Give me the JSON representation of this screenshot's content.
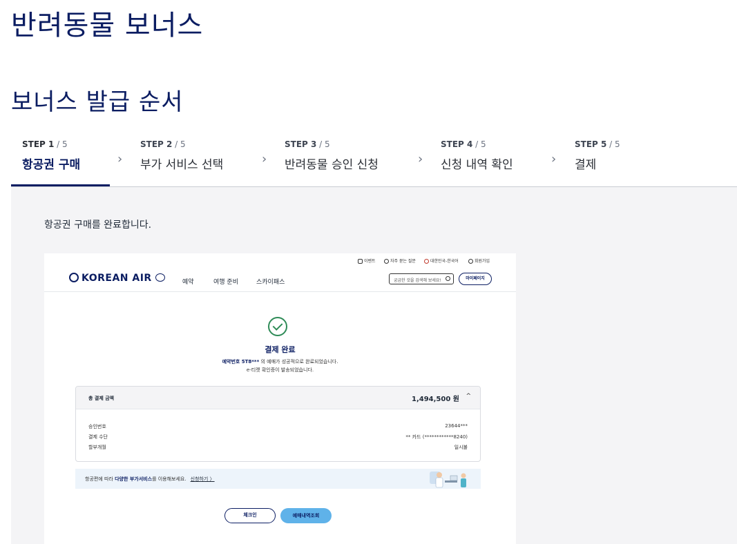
{
  "page": {
    "title": "반려동물 보너스",
    "subtitle": "보너스 발급 순서"
  },
  "steps": [
    {
      "num": "STEP 1",
      "total": " / 5",
      "label": "항공권 구매",
      "active": true
    },
    {
      "num": "STEP 2",
      "total": " / 5",
      "label": "부가 서비스 선택"
    },
    {
      "num": "STEP 3",
      "total": " / 5",
      "label": "반려동물 승인 신청"
    },
    {
      "num": "STEP 4",
      "total": " / 5",
      "label": "신청 내역 확인"
    },
    {
      "num": "STEP 5",
      "total": " / 5",
      "label": "결제"
    }
  ],
  "panel": {
    "description": "항공권 구매를 완료합니다."
  },
  "screenshot": {
    "util_links": [
      "이벤트",
      "자주 묻는 질문",
      "대한민국-한국어",
      "회원가입"
    ],
    "logo": "KOREAN AIR",
    "nav": [
      "예약",
      "여행 준비",
      "스카이패스"
    ],
    "search_placeholder": "궁금한 것을 검색해 보세요!",
    "mypage": "마이페이지",
    "done_title": "결제 완료",
    "done_msg_bold": "예약번호 5T8***",
    "done_msg_rest": " 의 예매가 성공적으로 완료되었습니다.",
    "done_msg2": "e-티켓 확인증이 발송되었습니다.",
    "pay_title": "총 결제 금액",
    "pay_amount": "1,494,500 원",
    "rows": [
      {
        "k": "승인번호",
        "v": "23644***"
      },
      {
        "k": "결제 수단",
        "v": "** 카드 (************8240)"
      },
      {
        "k": "할부개월",
        "v": "일시불"
      }
    ],
    "banner_pre": "항공편에 따라 ",
    "banner_bold": "다양한 부가서비스",
    "banner_post": "를 이용해보세요.",
    "banner_link": "신청하기 〉",
    "btn_checkin": "체크인",
    "btn_history": "예매내역조회"
  },
  "colors": {
    "brand_navy": "#0b1d62",
    "panel_bg": "#f4f4f6",
    "button_blue": "#5fb2e9",
    "success_green": "#2e8b57"
  }
}
